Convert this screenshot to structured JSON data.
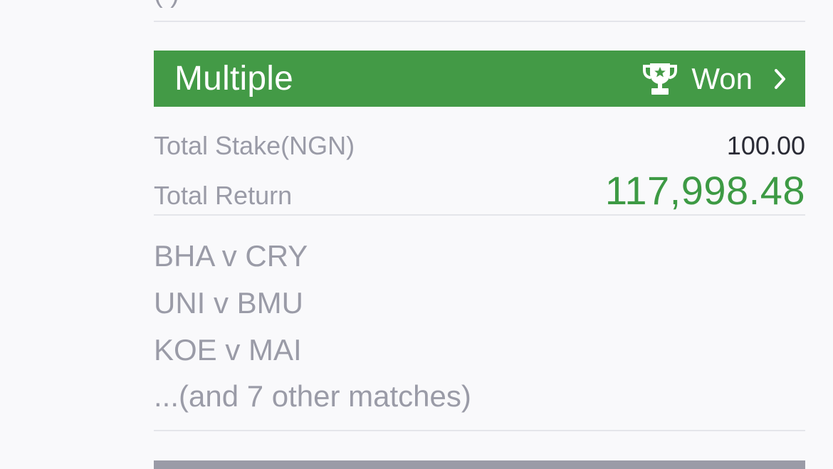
{
  "previous_card": {
    "partial_text": "(                                        )"
  },
  "bet": {
    "type": "Multiple",
    "status": "Won",
    "status_icon": "trophy-icon",
    "detail_icon": "chevron-right-icon",
    "header_color": "#439a46",
    "total_stake_label": "Total Stake(NGN)",
    "total_stake_value": "100.00",
    "total_return_label": "Total Return",
    "total_return_value": "117,998.48",
    "return_color": "#3d9a44",
    "matches": [
      "BHA v CRY",
      "UNI v BMU",
      "KOE v MAI"
    ],
    "more_matches": "...(and 7 other matches)"
  }
}
